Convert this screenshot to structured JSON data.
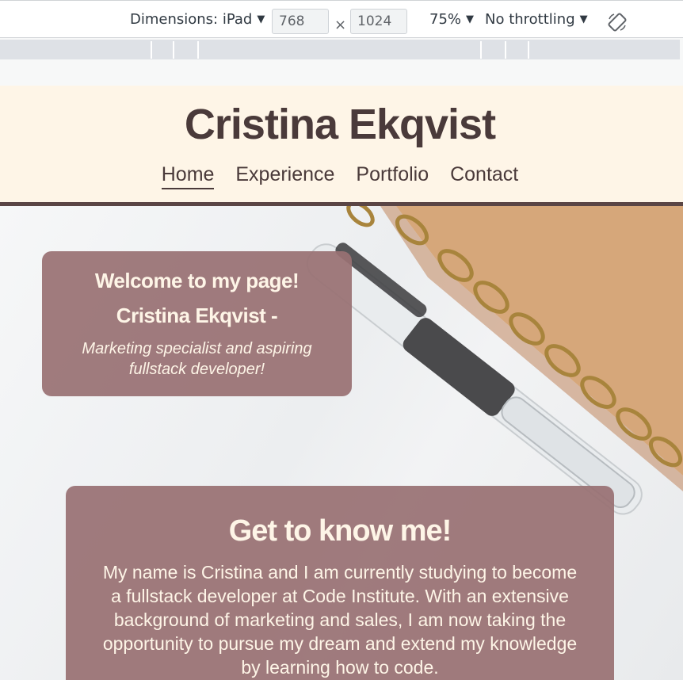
{
  "devtools": {
    "dimensions_label": "Dimensions: iPad",
    "width": "768",
    "height": "1024",
    "times": "×",
    "zoom": "75%",
    "throttling": "No throttling"
  },
  "site": {
    "title": "Cristina Ekqvist",
    "nav": [
      "Home",
      "Experience",
      "Portfolio",
      "Contact"
    ],
    "active_nav": "Home"
  },
  "welcome": {
    "heading": "Welcome to my page!",
    "name": "Cristina Ekqvist -",
    "tagline": "Marketing specialist and aspiring fullstack developer!"
  },
  "about": {
    "title": "Get to know me!",
    "text": "My name is Cristina and I am currently studying to become a fullstack developer at Code Institute. With an extensive background of marketing and sales, I am now taking the opportunity to pursue my dream and extend my knowledge by learning how to code."
  },
  "colors": {
    "header_bg": "#fef5e7",
    "brand_dark": "#4a3a3a",
    "card_bg": "#997173",
    "card_text": "#fef5e7"
  }
}
